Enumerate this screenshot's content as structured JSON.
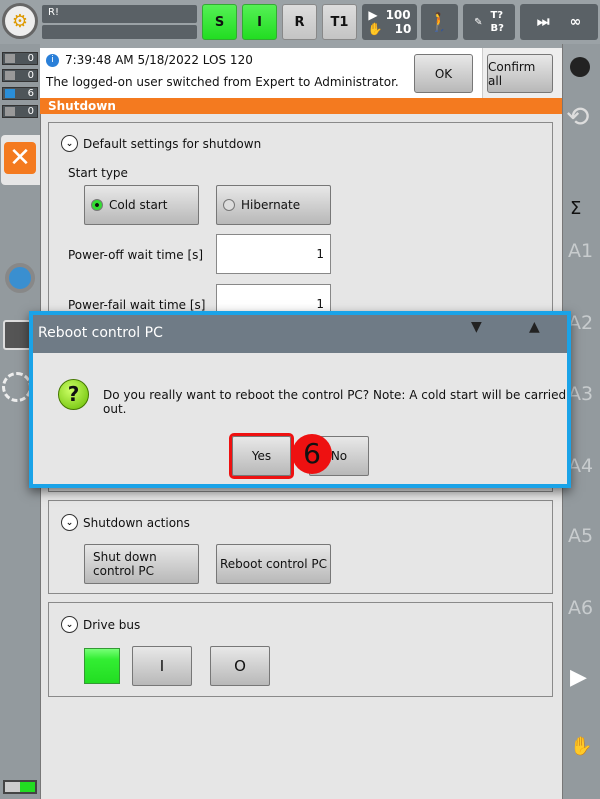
{
  "topbar": {
    "status_line1": "R!",
    "status_line2": "",
    "submit": "S",
    "drives": "I",
    "robot_interpreter": "R",
    "mode": "T1",
    "override_program": "100",
    "override_jog": "10",
    "tool_top": "T?",
    "tool_bottom": "B?",
    "increment": "∞"
  },
  "message_counters": [
    {
      "type": "error",
      "count": "0"
    },
    {
      "type": "warning",
      "count": "0"
    },
    {
      "type": "info",
      "count": "6"
    },
    {
      "type": "wait",
      "count": "0"
    }
  ],
  "message": {
    "header": "7:39:48 AM 5/18/2022 LOS 120",
    "text": "The logged-on user switched from Expert to Administrator.",
    "ok": "OK",
    "confirm_all": "Confirm all"
  },
  "window_title": "Shutdown",
  "default_settings": {
    "title": "Default settings for shutdown",
    "start_type_label": "Start type",
    "cold_start": "Cold start",
    "hibernate": "Hibernate",
    "selected": "Cold start",
    "power_off_label": "Power-off wait time [s]",
    "power_off_value": "1",
    "power_fail_label": "Power-fail wait time [s]",
    "power_fail_value": "1"
  },
  "shutdown_actions": {
    "title": "Shutdown actions",
    "shut_down": "Shut down control PC",
    "reboot": "Reboot control PC"
  },
  "drive_bus": {
    "title": "Drive bus",
    "on": "I",
    "off": "O",
    "state_color": "#22dd22"
  },
  "dialog": {
    "title": "Reboot control PC",
    "message": "Do you really want to reboot the control PC? Note: A cold start will be carried out.",
    "yes": "Yes",
    "no": "No"
  },
  "annotation": {
    "step": "6"
  },
  "right_bar": {
    "axes": [
      "A1",
      "A2",
      "A3",
      "A4",
      "A5",
      "A6"
    ]
  },
  "colors": {
    "accent_orange": "#f47a1f",
    "dialog_border": "#1aa3e8",
    "highlight": "#ee1111"
  }
}
